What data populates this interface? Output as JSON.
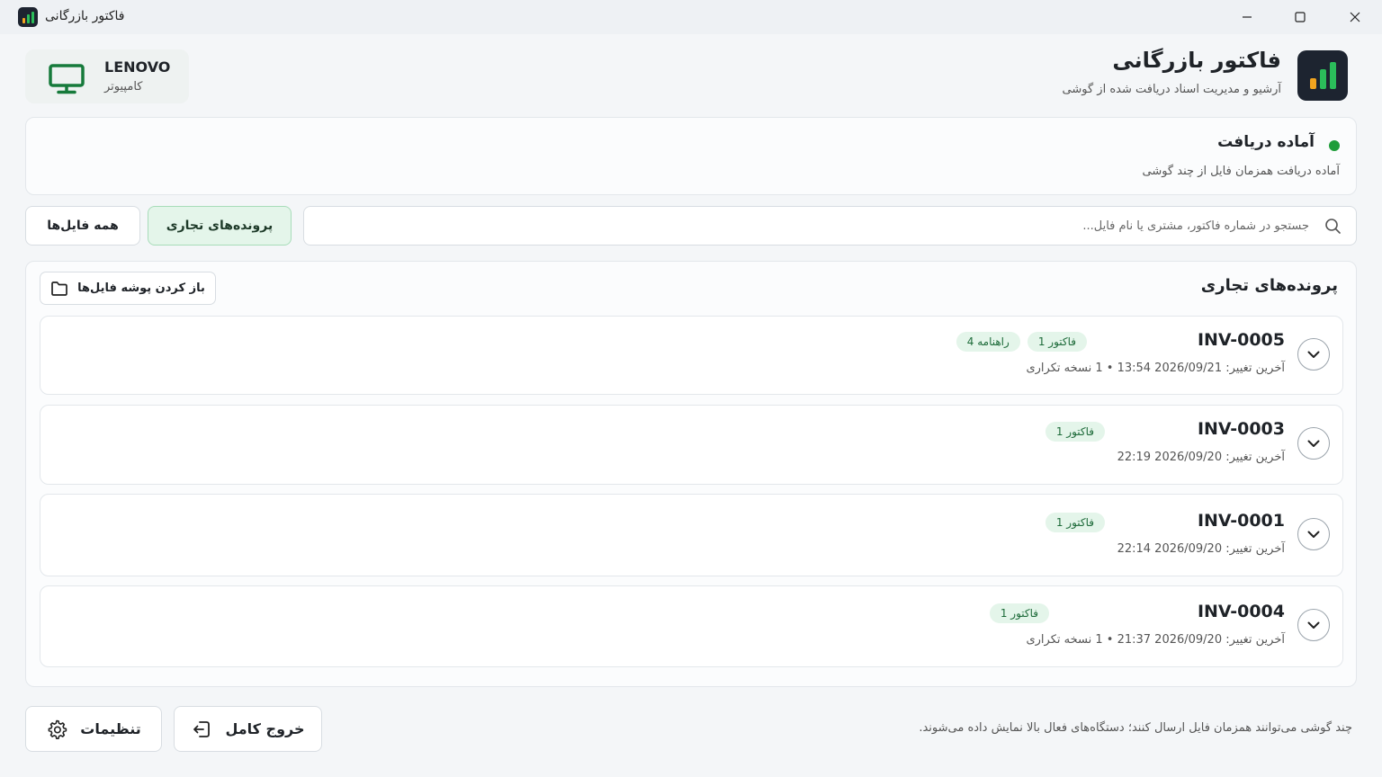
{
  "window": {
    "title": "فاکتور بازرگانی"
  },
  "device": {
    "name": "LENOVO",
    "type": "کامپیوتر"
  },
  "brand": {
    "title": "فاکتور بازرگانی",
    "subtitle": "آرشیو و مدیریت اسناد دریافت شده از گوشی",
    "colors": {
      "bar1": "#f2a51f",
      "bar2": "#2bbd5a",
      "bar3": "#2bbd5a"
    }
  },
  "status": {
    "title": "آماده دریافت",
    "subtitle": "آماده دریافت همزمان فایل از چند گوشی",
    "color": "#1f9d3a"
  },
  "search": {
    "placeholder": "جستجو در شماره فاکتور، مشتری یا نام فایل..."
  },
  "filters": {
    "business": "پرونده‌های تجاری",
    "all": "همه فایل‌ها"
  },
  "list": {
    "title": "پرونده‌های تجاری",
    "open_folder": "باز کردن پوشه فایل‌ها",
    "rows": [
      {
        "id": "INV-0005",
        "meta": "آخرین تغییر: 2026/09/21  13:54  •  1 نسخه تکراری",
        "badges": [
          "فاکتور 1",
          "راهنامه 4"
        ]
      },
      {
        "id": "INV-0003",
        "meta": "آخرین تغییر: 2026/09/20  22:19",
        "badges": [
          "فاکتور 1"
        ]
      },
      {
        "id": "INV-0001",
        "meta": "آخرین تغییر: 2026/09/20  22:14",
        "badges": [
          "فاکتور 1"
        ]
      },
      {
        "id": "INV-0004",
        "meta": "آخرین تغییر: 2026/09/20  21:37  •  1 نسخه تکراری",
        "badges": [
          "فاکتور 1"
        ]
      }
    ]
  },
  "footer": {
    "note": "چند گوشی می‌توانند همزمان فایل ارسال کنند؛ دستگاه‌های فعال بالا نمایش داده می‌شوند.",
    "exit": "خروج کامل",
    "settings": "تنظیمات"
  }
}
